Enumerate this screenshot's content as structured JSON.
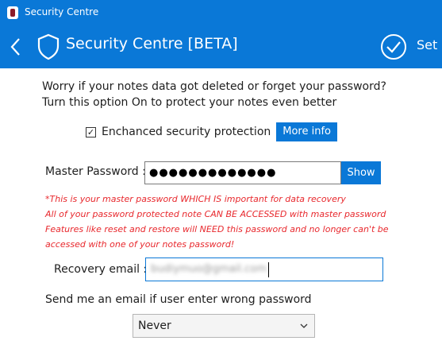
{
  "window": {
    "title": "Security Centre",
    "close_glyph": "✕"
  },
  "header": {
    "title": "Security Centre [BETA]",
    "set_label": "Set"
  },
  "intro": {
    "line1": "Worry if your notes data got deleted or forget your password?",
    "line2": "Turn this option On to protect your notes even better"
  },
  "toggle": {
    "label": "Enchanced security protection",
    "checked_glyph": "☑",
    "more_info": "More info"
  },
  "password": {
    "label": "Master Password :",
    "masked_value": "●●●●●●●●●●●●●",
    "show_label": "Show"
  },
  "warning": [
    "*This is your master password WHICH IS important for data recovery",
    "All of your password protected note CAN BE ACCESSED with master password",
    "Features like reset and restore will NEED this password and no longer can't be",
    "accessed with one of your notes password!"
  ],
  "recovery": {
    "label": "Recovery email :",
    "value": "budiymuo@gmail.com"
  },
  "wrong_password": {
    "label": "Send me an email if user enter wrong password",
    "selected": "Never"
  },
  "colors": {
    "accent": "#0a78d7",
    "warning": "#e8282d"
  },
  "icons": [
    "app-icon",
    "back-arrow-icon",
    "shield-icon",
    "check-circle-icon",
    "checkbox-icon",
    "chevron-down-icon"
  ]
}
